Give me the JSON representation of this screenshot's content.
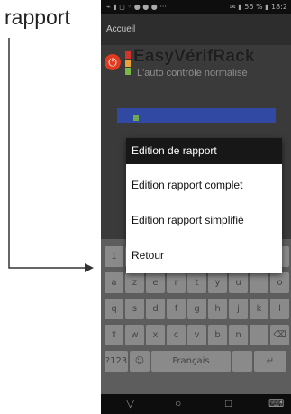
{
  "annotation": {
    "label": "rapport"
  },
  "statusbar": {
    "left_text": "⌁ ▮ ◻ ◦ ● ● ●  ···",
    "right_text": "✉ ▮ 56 % ▮ 18:2"
  },
  "header": {
    "title": "Accueil"
  },
  "app": {
    "brand": "EasyVérifRack",
    "tagline": "L'auto contrôle normalisé",
    "colors": {
      "power": "#e03a1f",
      "band": "#3149a3",
      "bar_red": "#d3352b",
      "bar_orange": "#e9a33a",
      "bar_green": "#7ab648"
    }
  },
  "dialog": {
    "title": "Edition de rapport",
    "items": [
      "Edition rapport complet",
      "Edition rapport simplifié",
      "Retour"
    ]
  },
  "keyboard": {
    "rows": [
      [
        "1",
        "2",
        "3",
        "4",
        "5",
        "6",
        "7",
        "8",
        "9"
      ],
      [
        "a",
        "z",
        "e",
        "r",
        "t",
        "y",
        "u",
        "i",
        "o"
      ],
      [
        "q",
        "s",
        "d",
        "f",
        "g",
        "h",
        "j",
        "k",
        "l"
      ],
      [
        "⇧",
        "w",
        "x",
        "c",
        "v",
        "b",
        "n",
        "'",
        "⌫"
      ]
    ],
    "bottom": [
      "?123",
      "☺",
      "Français",
      "",
      "↵"
    ]
  },
  "navbar": {
    "back": "▽",
    "home": "○",
    "recent": "□",
    "keyboard": "⌨"
  }
}
